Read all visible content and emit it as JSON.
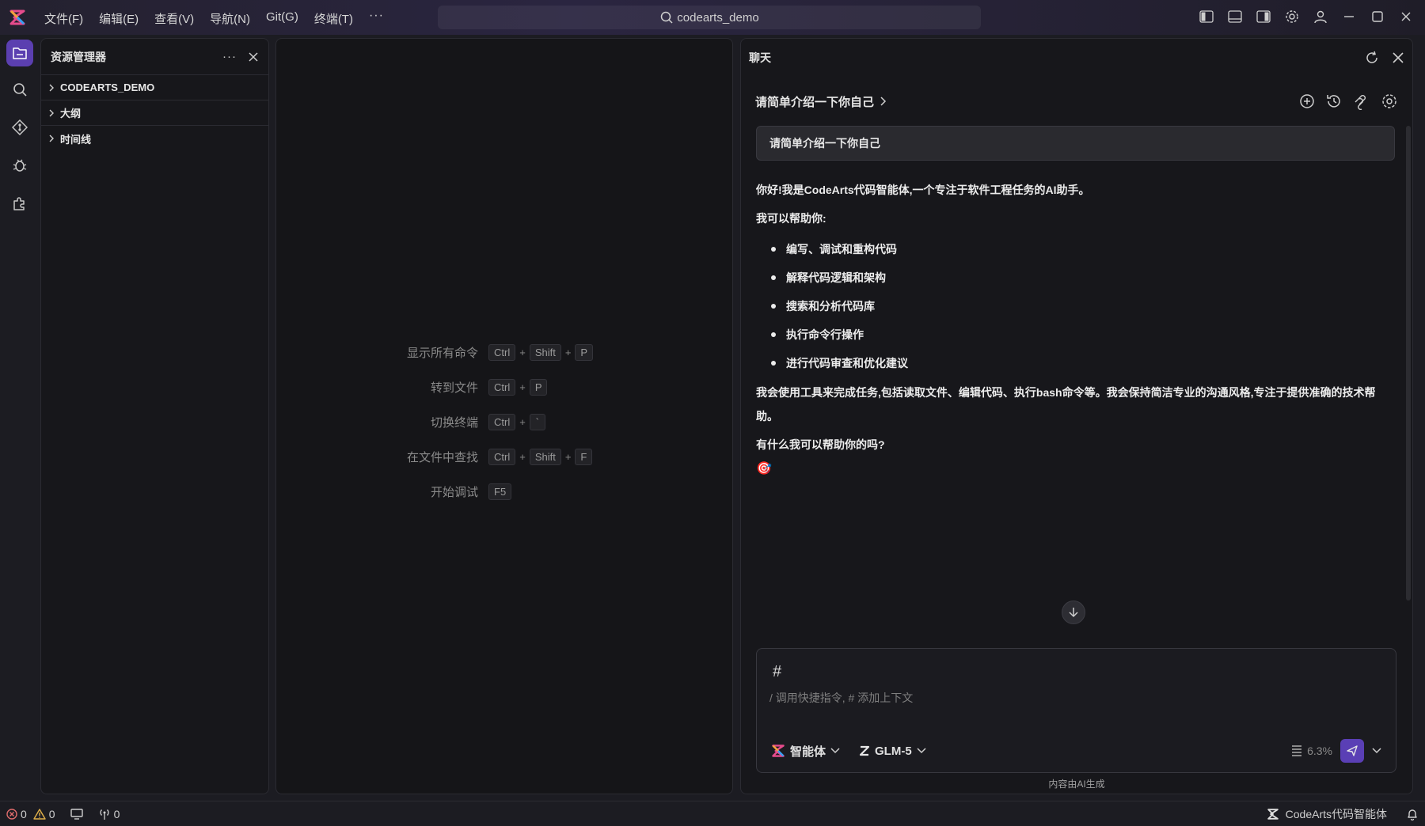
{
  "menu": [
    "文件(F)",
    "编辑(E)",
    "查看(V)",
    "导航(N)",
    "Git(G)",
    "终端(T)"
  ],
  "menu_more": "···",
  "search": {
    "text": "codearts_demo"
  },
  "explorer": {
    "title": "资源管理器",
    "more": "···",
    "items": [
      {
        "label": "CODEARTS_DEMO"
      },
      {
        "label": "大纲"
      },
      {
        "label": "时间线"
      }
    ]
  },
  "shortcuts": [
    {
      "label": "显示所有命令",
      "keys": [
        "Ctrl",
        "Shift",
        "P"
      ]
    },
    {
      "label": "转到文件",
      "keys": [
        "Ctrl",
        "P"
      ]
    },
    {
      "label": "切换终端",
      "keys": [
        "Ctrl",
        "`"
      ]
    },
    {
      "label": "在文件中查找",
      "keys": [
        "Ctrl",
        "Shift",
        "F"
      ]
    },
    {
      "label": "开始调试",
      "keys": [
        "F5"
      ]
    }
  ],
  "chat": {
    "title": "聊天",
    "conversation_title": "请简单介绍一下你自己",
    "user_message": "请简单介绍一下你自己",
    "answer": {
      "intro": "你好!我是CodeArts代码智能体,一个专注于软件工程任务的AI助手。",
      "can_help": "我可以帮助你:",
      "bullets": [
        "编写、调试和重构代码",
        "解释代码逻辑和架构",
        "搜索和分析代码库",
        "执行命令行操作",
        "进行代码审查和优化建议"
      ],
      "tools": "我会使用工具来完成任务,包括读取文件、编辑代码、执行bash命令等。我会保持简洁专业的沟通风格,专注于提供准确的技术帮助。",
      "question": "有什么我可以帮助你的吗?",
      "emoji": "🎯"
    },
    "composer": {
      "hash": "#",
      "placeholder": "/ 调用快捷指令, # 添加上下文",
      "agent": "智能体",
      "model": "GLM-5",
      "context_usage": "6.3%"
    },
    "ai_note": "内容由AI生成"
  },
  "status": {
    "errors": "0",
    "warnings": "0",
    "ports": "0",
    "agent_name": "CodeArts代码智能体"
  },
  "colors": {
    "accent": "#5b3fb0",
    "background": "#17171b",
    "error": "#e06c6c",
    "warning": "#e0b04a"
  }
}
